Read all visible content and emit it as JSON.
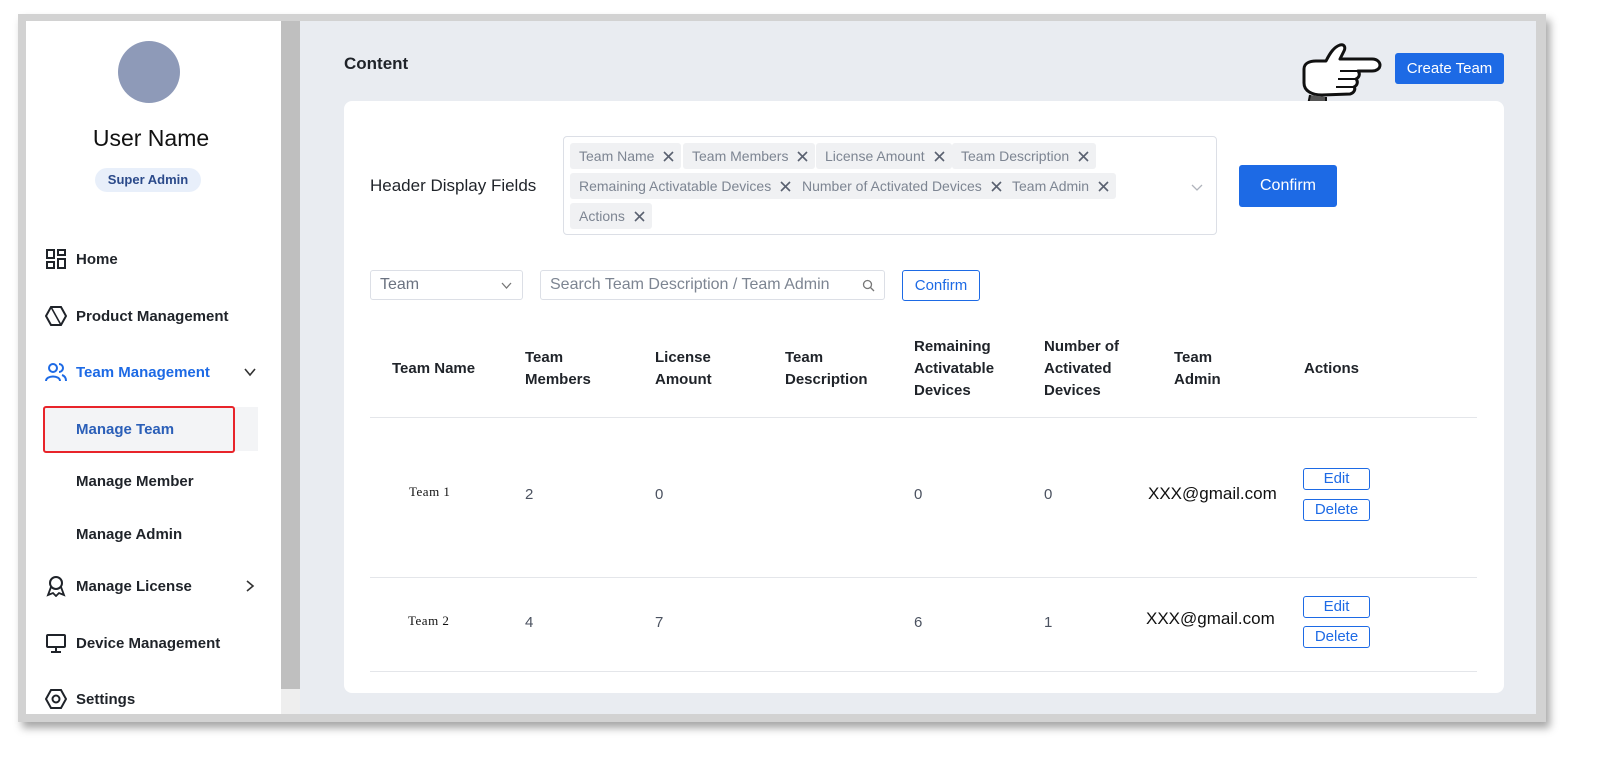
{
  "sidebar": {
    "user_name": "User Name",
    "role": "Super Admin",
    "items": [
      {
        "label": "Home",
        "icon": "grid-icon"
      },
      {
        "label": "Product Management",
        "icon": "hexagon-icon"
      },
      {
        "label": "Team Management",
        "icon": "users-icon",
        "expanded": true
      },
      {
        "label": "Manage License",
        "icon": "award-icon"
      },
      {
        "label": "Device Management",
        "icon": "monitor-icon"
      },
      {
        "label": "Settings",
        "icon": "settings-icon"
      }
    ],
    "sub_items": [
      {
        "label": "Manage Team",
        "active": true
      },
      {
        "label": "Manage Member"
      },
      {
        "label": "Manage Admin"
      }
    ]
  },
  "main": {
    "title": "Content",
    "create_team_label": "Create Team",
    "header_display_fields_label": "Header Display Fields",
    "selected_fields": [
      "Team Name",
      "Team Members",
      "License Amount",
      "Team Description",
      "Remaining Activatable Devices",
      "Number of Activated Devices",
      "Team Admin",
      "Actions"
    ],
    "confirm_fields_label": "Confirm",
    "filter": {
      "team_select_value": "Team",
      "search_placeholder": "Search Team Description / Team Admin",
      "confirm_label": "Confirm"
    },
    "table": {
      "columns": [
        [
          "Team Name"
        ],
        [
          "Team",
          "Members"
        ],
        [
          "License",
          "Amount"
        ],
        [
          "Team",
          "Description"
        ],
        [
          "Remaining",
          "Activatable",
          "Devices"
        ],
        [
          "Number of",
          "Activated",
          "Devices"
        ],
        [
          "Team",
          "Admin"
        ],
        [
          "Actions"
        ]
      ],
      "rows": [
        {
          "team_name": "Team 1",
          "members": "2",
          "license_amount": "0",
          "description": "",
          "remaining": "0",
          "activated": "0",
          "admin": "XXX@gmail.com"
        },
        {
          "team_name": "Team 2",
          "members": "4",
          "license_amount": "7",
          "description": "",
          "remaining": "6",
          "activated": "1",
          "admin": "XXX@gmail.com"
        }
      ],
      "edit_label": "Edit",
      "delete_label": "Delete"
    }
  },
  "colors": {
    "primary": "#1d6ae5",
    "highlight": "#e8242a",
    "background": "#e9ecf1"
  }
}
